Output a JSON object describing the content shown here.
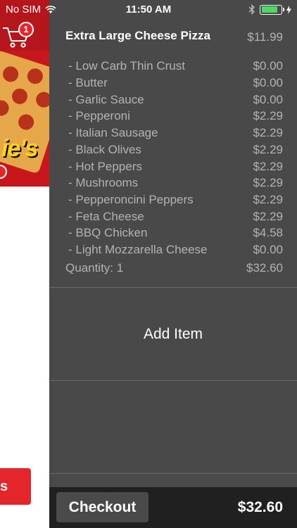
{
  "status": {
    "carrier": "No SIM",
    "time": "11:50 AM",
    "battery_level": 0.85,
    "battery_color": "#4cd964"
  },
  "background": {
    "cart_icon": "cart-icon",
    "cart_badge": "1",
    "brand_fragment": "ie's",
    "button_fragment": "s"
  },
  "cart": {
    "item": {
      "title": "Extra Large Cheese Pizza",
      "price": "$11.99",
      "options": [
        {
          "name": "- Low Carb Thin Crust",
          "price": "$0.00"
        },
        {
          "name": "- Butter",
          "price": "$0.00"
        },
        {
          "name": "- Garlic Sauce",
          "price": "$0.00"
        },
        {
          "name": "- Pepperoni",
          "price": "$2.29"
        },
        {
          "name": "- Italian Sausage",
          "price": "$2.29"
        },
        {
          "name": "- Black Olives",
          "price": "$2.29"
        },
        {
          "name": "- Hot Peppers",
          "price": "$2.29"
        },
        {
          "name": "- Mushrooms",
          "price": "$2.29"
        },
        {
          "name": "- Pepperoncini Peppers",
          "price": "$2.29"
        },
        {
          "name": "- Feta Cheese",
          "price": "$2.29"
        },
        {
          "name": "- BBQ Chicken",
          "price": "$4.58"
        },
        {
          "name": "- Light Mozzarella Cheese",
          "price": "$0.00"
        }
      ],
      "quantity_label": "Quantity: 1",
      "line_total": "$32.60"
    },
    "add_item_label": "Add Item",
    "checkout_label": "Checkout",
    "total": "$32.60"
  },
  "colors": {
    "brand_red": "#b5161c",
    "panel_bg": "#494949",
    "checkout_bar": "#202020"
  }
}
